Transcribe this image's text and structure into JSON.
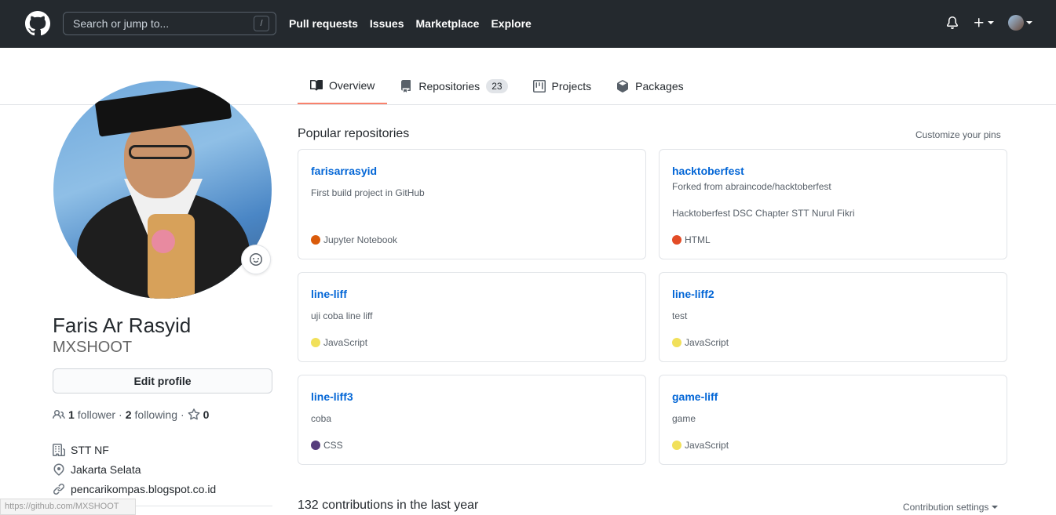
{
  "header": {
    "search_placeholder": "Search or jump to...",
    "search_shortcut": "/",
    "nav": [
      "Pull requests",
      "Issues",
      "Marketplace",
      "Explore"
    ]
  },
  "tabs": [
    {
      "label": "Overview",
      "icon": "book-icon",
      "selected": true
    },
    {
      "label": "Repositories",
      "icon": "repo-icon",
      "counter": "23"
    },
    {
      "label": "Projects",
      "icon": "project-icon"
    },
    {
      "label": "Packages",
      "icon": "package-icon"
    }
  ],
  "profile": {
    "full_name": "Faris Ar Rasyid",
    "username": "MXSHOOT",
    "edit_label": "Edit profile",
    "followers": "1",
    "followers_label": "follower",
    "following": "2",
    "following_label": "following",
    "stars": "0",
    "company": "STT NF",
    "location": "Jakarta Selata",
    "website": "pencarikompas.blogspot.co.id",
    "status_url": "https://github.com/MXSHOOT"
  },
  "popular": {
    "title": "Popular repositories",
    "customize": "Customize your pins",
    "repos": [
      {
        "name": "farisarrasyid",
        "desc": "First build project in GitHub",
        "lang": "Jupyter Notebook",
        "color": "#DA5B0B"
      },
      {
        "name": "hacktoberfest",
        "fork": "Forked from abraincode/hacktoberfest",
        "desc": "Hacktoberfest DSC Chapter STT Nurul Fikri",
        "lang": "HTML",
        "color": "#e34c26"
      },
      {
        "name": "line-liff",
        "desc": "uji coba line liff",
        "lang": "JavaScript",
        "color": "#f1e05a"
      },
      {
        "name": "line-liff2",
        "desc": "test",
        "lang": "JavaScript",
        "color": "#f1e05a"
      },
      {
        "name": "line-liff3",
        "desc": "coba",
        "lang": "CSS",
        "color": "#563d7c"
      },
      {
        "name": "game-liff",
        "desc": "game",
        "lang": "JavaScript",
        "color": "#f1e05a"
      }
    ]
  },
  "contributions": {
    "title": "132 contributions in the last year",
    "settings": "Contribution settings"
  }
}
